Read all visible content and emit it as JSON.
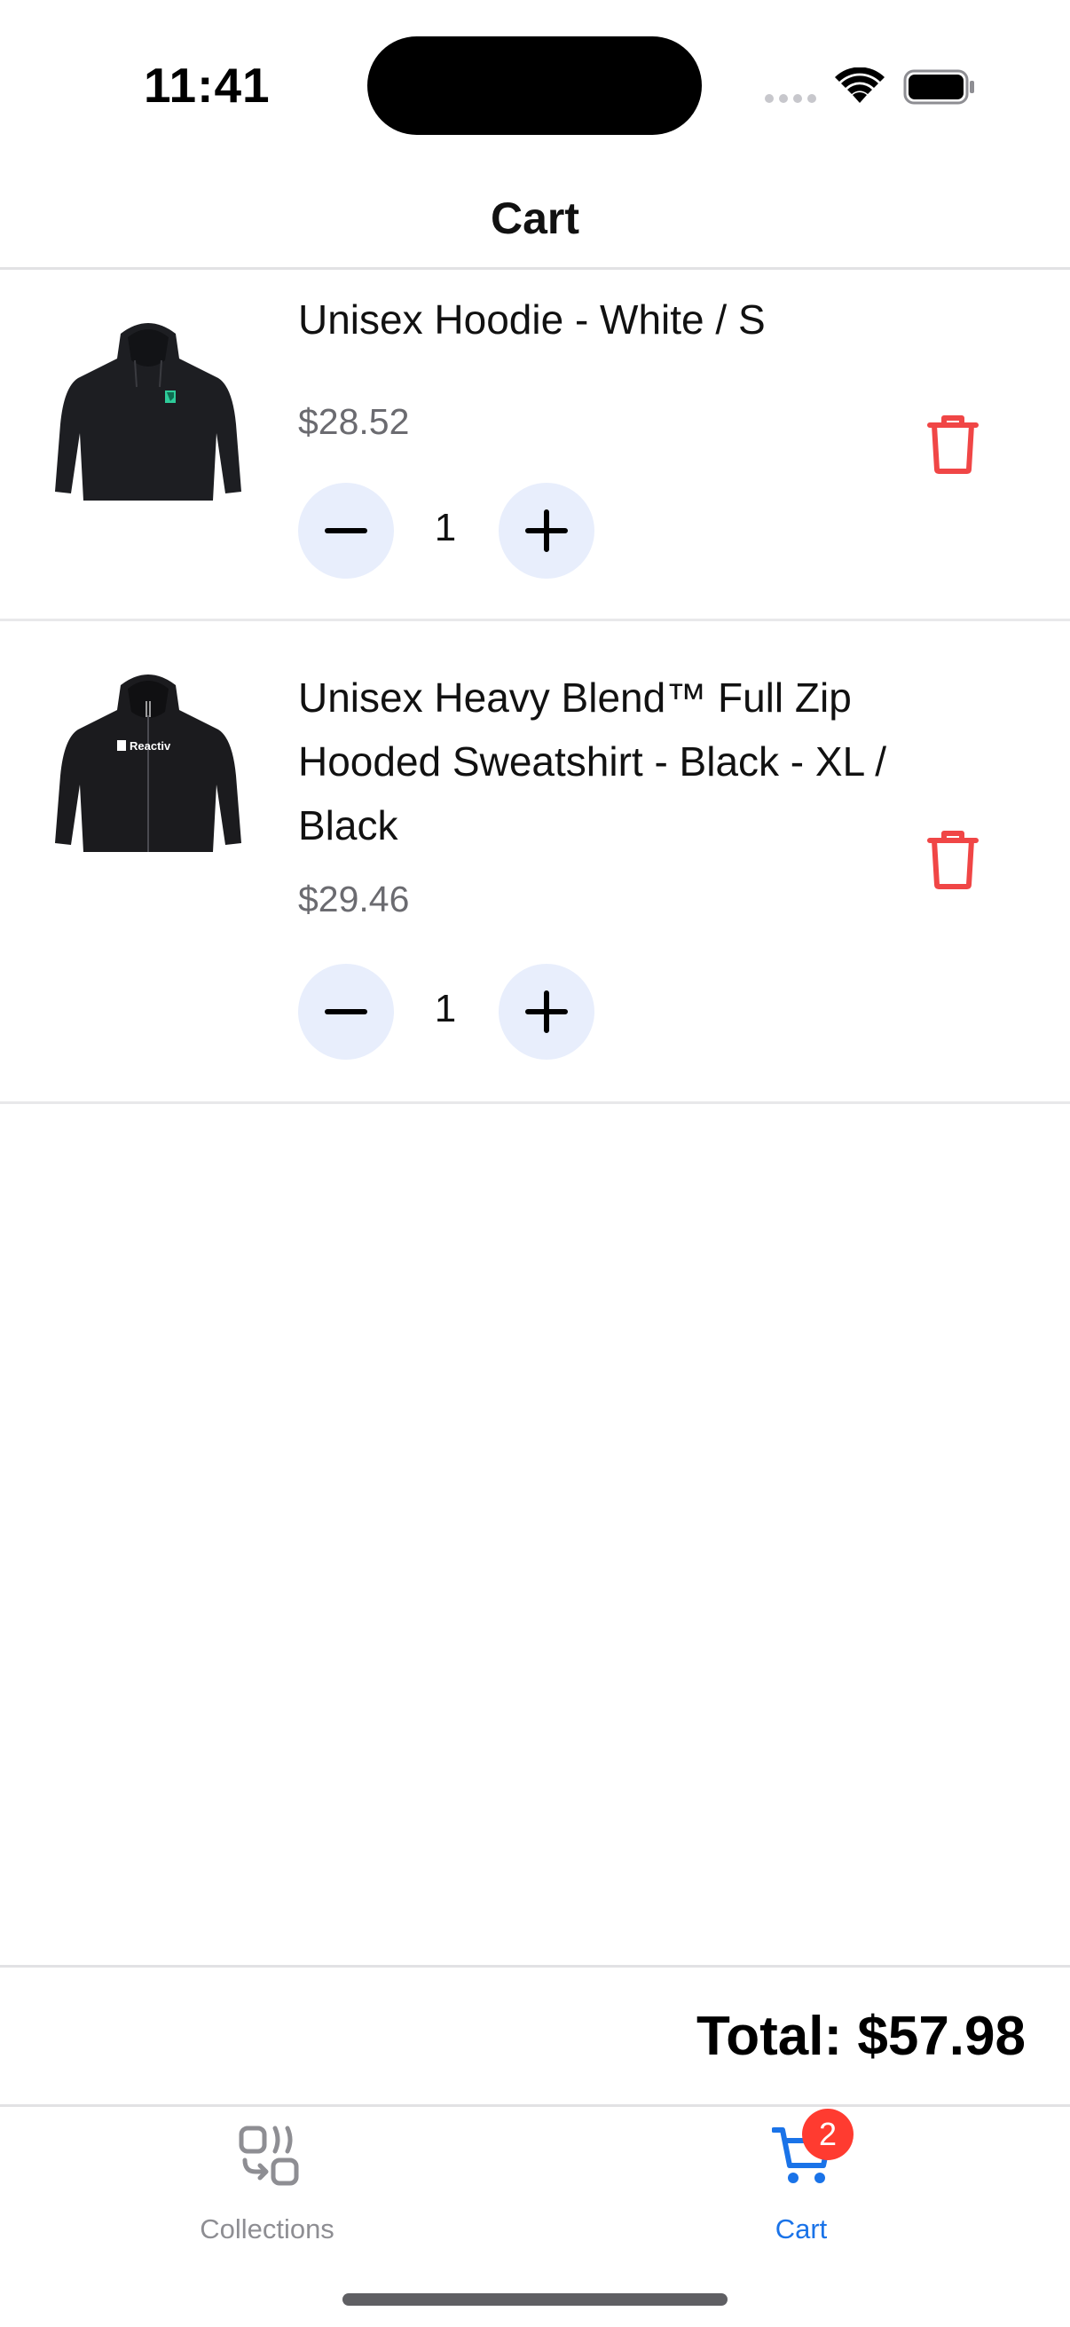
{
  "status_bar": {
    "time": "11:41"
  },
  "header": {
    "title": "Cart"
  },
  "cart": {
    "items": [
      {
        "name": "Unisex Hoodie - White / S",
        "price": "$28.52",
        "quantity": "1",
        "image": "black-pullover-hoodie",
        "logo_color": "#2ecc9a"
      },
      {
        "name": "Unisex Heavy Blend™ Full Zip Hooded Sweatshirt - Black - XL / Black",
        "price": "$29.46",
        "quantity": "1",
        "image": "black-zip-hoodie",
        "logo_text": "Reactiv"
      }
    ]
  },
  "total": {
    "text": "Total: $57.98"
  },
  "tab_bar": {
    "tabs": [
      {
        "label": "Collections",
        "icon": "collections-icon",
        "active": false
      },
      {
        "label": "Cart",
        "icon": "cart-icon",
        "active": true,
        "badge": "2"
      }
    ]
  },
  "colors": {
    "accent": "#1a73e8",
    "delete": "#f04646",
    "badge": "#ff3b30",
    "qty_button_bg": "#e8eefc"
  }
}
